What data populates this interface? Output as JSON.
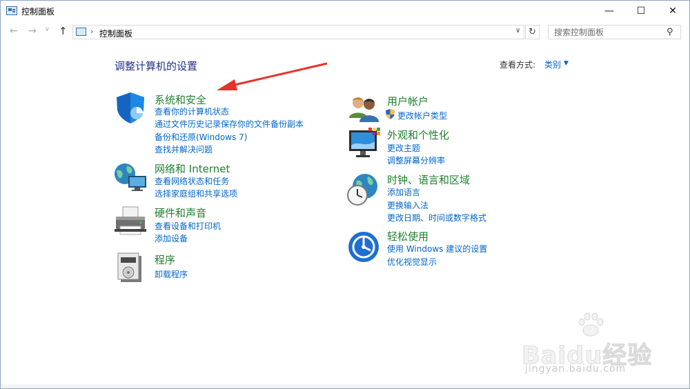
{
  "window": {
    "title": "控制面板"
  },
  "address": {
    "path": "控制面板",
    "separator": "›"
  },
  "search": {
    "placeholder": "搜索控制面板"
  },
  "page": {
    "heading": "调整计算机的设置",
    "view_by_label": "查看方式:",
    "view_by_value": "类别"
  },
  "categories": [
    {
      "title": "系统和安全",
      "icon": "shield-icon",
      "links": [
        "查看你的计算机状态",
        "通过文件历史记录保存你的文件备份副本",
        "备份和还原(Windows 7)",
        "查找并解决问题"
      ]
    },
    {
      "title": "网络和 Internet",
      "icon": "network-globe-icon",
      "links": [
        "查看网络状态和任务",
        "选择家庭组和共享选项"
      ]
    },
    {
      "title": "硬件和声音",
      "icon": "printer-icon",
      "links": [
        "查看设备和打印机",
        "添加设备"
      ]
    },
    {
      "title": "程序",
      "icon": "programs-icon",
      "links": [
        "卸载程序"
      ]
    },
    {
      "title": "用户帐户",
      "icon": "users-icon",
      "links": [
        "更改帐户类型"
      ]
    },
    {
      "title": "外观和个性化",
      "icon": "monitor-icon",
      "links": [
        "更改主题",
        "调整屏幕分辨率"
      ]
    },
    {
      "title": "时钟、语言和区域",
      "icon": "clock-globe-icon",
      "links": [
        "添加语言",
        "更换输入法",
        "更改日期、时间或数字格式"
      ]
    },
    {
      "title": "轻松使用",
      "icon": "ease-of-access-icon",
      "links": [
        "使用 Windows 建议的设置",
        "优化视觉显示"
      ]
    }
  ],
  "watermark": {
    "text": "Baidu经验",
    "sub": "jingyan.baidu.com"
  },
  "colors": {
    "category_title": "#1e7f2e",
    "link": "#0066cc",
    "heading": "#1e3287",
    "annotation_arrow": "#e8322c"
  }
}
